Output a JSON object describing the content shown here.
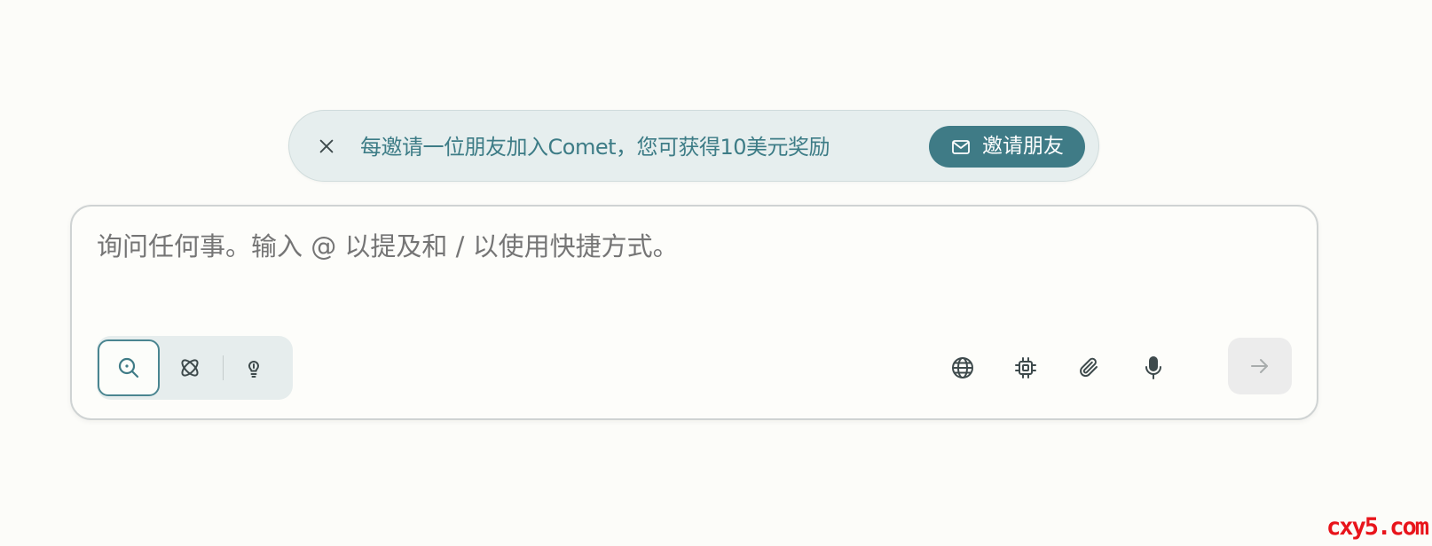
{
  "banner": {
    "message": "每邀请一位朋友加入Comet，您可获得10美元奖励",
    "invite_label": "邀请朋友",
    "close_icon": "close-icon",
    "mail_icon": "mail-icon"
  },
  "composer": {
    "placeholder": "询问任何事。输入 @ 以提及和 / 以使用快捷方式。",
    "value": "",
    "modes": [
      {
        "name": "search",
        "icon": "search-icon",
        "active": true
      },
      {
        "name": "research",
        "icon": "atom-icon",
        "active": false
      },
      {
        "name": "labs",
        "icon": "lightbulb-icon",
        "active": false
      }
    ],
    "tools": [
      {
        "name": "web",
        "icon": "globe-icon"
      },
      {
        "name": "model",
        "icon": "cpu-chip-icon"
      },
      {
        "name": "attach",
        "icon": "paperclip-icon"
      },
      {
        "name": "voice",
        "icon": "microphone-icon"
      }
    ],
    "submit_icon": "arrow-right-icon"
  },
  "watermark": {
    "text": "cxy5.com"
  },
  "colors": {
    "accent": "#3f7b86",
    "banner_bg": "#e6eeee",
    "page_bg": "#fcfcf9",
    "placeholder": "#9aa0a0",
    "watermark": "#e8141b"
  }
}
